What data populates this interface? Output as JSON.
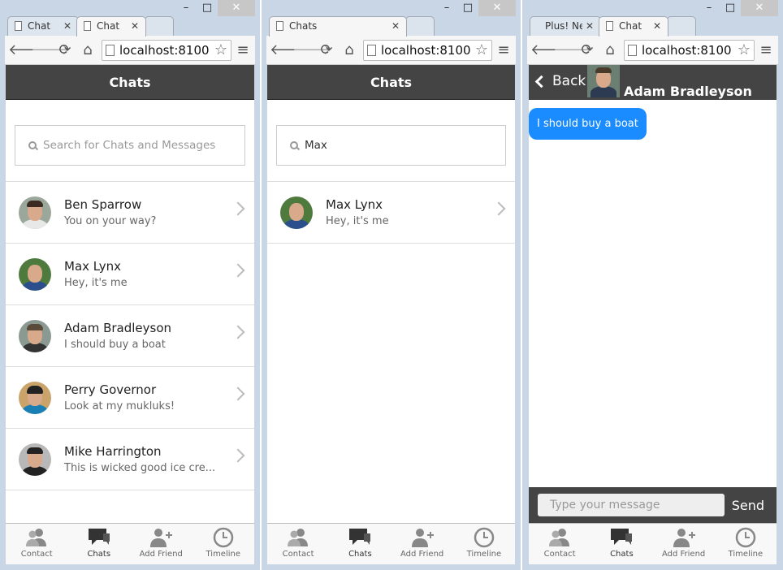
{
  "window_controls": {
    "minimize": "–",
    "maximize": "□",
    "close": "✕"
  },
  "windows": [
    {
      "tabs": [
        {
          "title": "Chat",
          "active": false
        },
        {
          "title": "Chat",
          "active": true
        }
      ],
      "url": "localhost:8100",
      "header_title": "Chats",
      "search": {
        "placeholder": "Search for Chats and Messages",
        "value": ""
      },
      "chats": [
        {
          "name": "Ben Sparrow",
          "message": "You on your way?"
        },
        {
          "name": "Max Lynx",
          "message": "Hey, it's me"
        },
        {
          "name": "Adam Bradleyson",
          "message": "I should buy a boat"
        },
        {
          "name": "Perry Governor",
          "message": "Look at my mukluks!"
        },
        {
          "name": "Mike Harrington",
          "message": "This is wicked good ice cre..."
        }
      ]
    },
    {
      "tabs": [
        {
          "title": "Chats",
          "active": true
        }
      ],
      "url": "localhost:8100",
      "header_title": "Chats",
      "search": {
        "placeholder": "",
        "value": "Max"
      },
      "chats": [
        {
          "name": "Max Lynx",
          "message": "Hey, it's me"
        }
      ]
    },
    {
      "tabs": [
        {
          "title": "Plus! Ne",
          "active": false
        },
        {
          "title": "Chat",
          "active": true
        }
      ],
      "url": "localhost:8100",
      "chat": {
        "back_label": "Back",
        "contact_name": "Adam Bradleyson",
        "messages": [
          "I should buy a boat"
        ],
        "composer_placeholder": "Type your message",
        "send_label": "Send"
      }
    }
  ],
  "tabbar": [
    {
      "label": "Contact",
      "icon": "contacts-icon"
    },
    {
      "label": "Chats",
      "icon": "chats-icon",
      "active": true
    },
    {
      "label": "Add Friend",
      "icon": "add-friend-icon"
    },
    {
      "label": "Timeline",
      "icon": "clock-icon"
    }
  ],
  "colors": {
    "header": "#444444",
    "bubble": "#1a8cff",
    "active_tab": "#333333"
  }
}
